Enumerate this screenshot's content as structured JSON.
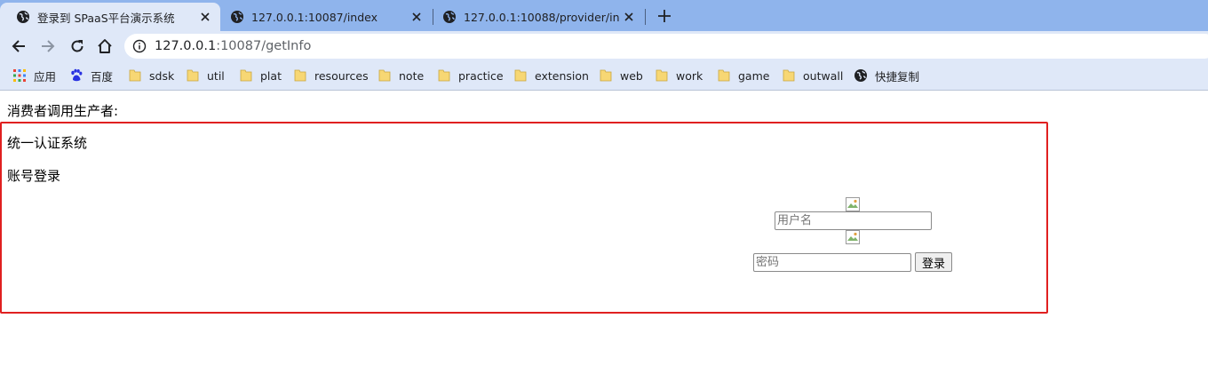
{
  "tabs": [
    {
      "title": "登录到 SPaaS平台演示系统",
      "active": true
    },
    {
      "title": "127.0.0.1:10087/index",
      "active": false
    },
    {
      "title": "127.0.0.1:10088/provider/index",
      "active": false
    }
  ],
  "address_bar": {
    "host": "127.0.0.1",
    "rest": ":10087/getInfo"
  },
  "bookmarks": [
    {
      "label": "应用",
      "icon": "apps-grid-icon"
    },
    {
      "label": "百度",
      "icon": "baidu-paw-icon"
    },
    {
      "label": "sdsk",
      "icon": "folder-icon"
    },
    {
      "label": "util",
      "icon": "folder-icon"
    },
    {
      "label": "plat",
      "icon": "folder-icon"
    },
    {
      "label": "resources",
      "icon": "folder-icon"
    },
    {
      "label": "note",
      "icon": "folder-icon"
    },
    {
      "label": "practice",
      "icon": "folder-icon"
    },
    {
      "label": "extension",
      "icon": "folder-icon"
    },
    {
      "label": "web",
      "icon": "folder-icon"
    },
    {
      "label": "work",
      "icon": "folder-icon"
    },
    {
      "label": "game",
      "icon": "folder-icon"
    },
    {
      "label": "outwall",
      "icon": "folder-icon"
    },
    {
      "label": "快捷复制",
      "icon": "globe-icon"
    }
  ],
  "page": {
    "consumer_label": "消费者调用生产者:",
    "system_title": "统一认证系统",
    "login_title": "账号登录",
    "username_placeholder": "用户名",
    "password_placeholder": "密码",
    "login_button": "登录"
  },
  "colors": {
    "tabstrip": "#8fb4ec",
    "toolbar": "#dfe8f8",
    "frame_border": "#e02020",
    "folder": "#f7d774"
  }
}
